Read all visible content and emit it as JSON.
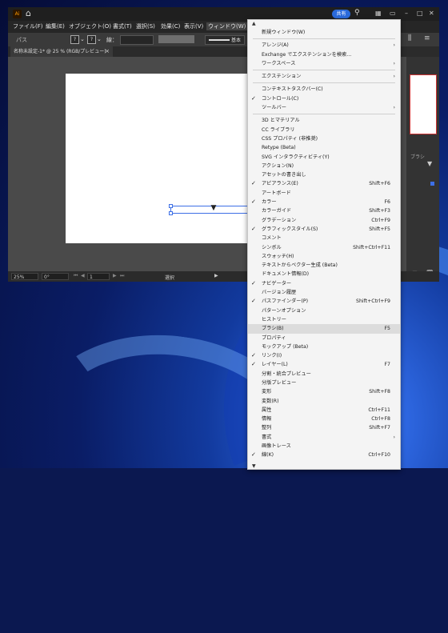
{
  "app": {
    "logo_text": "Ai",
    "share_label": "共有",
    "menus": [
      "ファイル(F)",
      "編集(E)",
      "オブジェクト(O)",
      "書式(T)",
      "選択(S)",
      "効果(C)",
      "表示(V)",
      "ウィンドウ(W)"
    ]
  },
  "controlbar": {
    "path_label": "パス",
    "stroke_label": "線：",
    "stroke_style_label": "基本"
  },
  "document": {
    "tab_label": "名称未設定-1* @ 25 % (RGB/プレビュー)"
  },
  "statusbar": {
    "zoom": "25%",
    "rotation": "0°",
    "page": "1",
    "tool": "選択"
  },
  "right_panel": {
    "label": "ブラシ"
  },
  "window_menu": {
    "items": [
      {
        "label": "新規ウィンドウ(W)",
        "checked": false,
        "shortcut": "",
        "submenu": false,
        "sep_after": true
      },
      {
        "label": "アレンジ(A)",
        "checked": false,
        "shortcut": "",
        "submenu": true,
        "sep_after": false
      },
      {
        "label": "Exchange でエクステンションを検索...",
        "checked": false,
        "shortcut": "",
        "submenu": false,
        "sep_after": false
      },
      {
        "label": "ワークスペース",
        "checked": false,
        "shortcut": "",
        "submenu": true,
        "sep_after": true
      },
      {
        "label": "エクステンション",
        "checked": false,
        "shortcut": "",
        "submenu": true,
        "sep_after": true
      },
      {
        "label": "コンテキストタスクバー(C)",
        "checked": false,
        "shortcut": "",
        "submenu": false,
        "sep_after": false
      },
      {
        "label": "コントロール(C)",
        "checked": true,
        "shortcut": "",
        "submenu": false,
        "sep_after": false
      },
      {
        "label": "ツールバー",
        "checked": false,
        "shortcut": "",
        "submenu": true,
        "sep_after": true
      },
      {
        "label": "3D とマテリアル",
        "checked": false,
        "shortcut": "",
        "submenu": false,
        "sep_after": false
      },
      {
        "label": "CC ライブラリ",
        "checked": false,
        "shortcut": "",
        "submenu": false,
        "sep_after": false
      },
      {
        "label": "CSS プロパティ (非推奨)",
        "checked": false,
        "shortcut": "",
        "submenu": false,
        "sep_after": false
      },
      {
        "label": "Retype (Beta)",
        "checked": false,
        "shortcut": "",
        "submenu": false,
        "sep_after": false
      },
      {
        "label": "SVG インタラクティビティ(Y)",
        "checked": false,
        "shortcut": "",
        "submenu": false,
        "sep_after": false
      },
      {
        "label": "アクション(N)",
        "checked": false,
        "shortcut": "",
        "submenu": false,
        "sep_after": false
      },
      {
        "label": "アセットの書き出し",
        "checked": false,
        "shortcut": "",
        "submenu": false,
        "sep_after": false
      },
      {
        "label": "アピアランス(E)",
        "checked": true,
        "shortcut": "Shift+F6",
        "submenu": false,
        "sep_after": false
      },
      {
        "label": "アートボード",
        "checked": false,
        "shortcut": "",
        "submenu": false,
        "sep_after": false
      },
      {
        "label": "カラー",
        "checked": true,
        "shortcut": "F6",
        "submenu": false,
        "sep_after": false
      },
      {
        "label": "カラーガイド",
        "checked": false,
        "shortcut": "Shift+F3",
        "submenu": false,
        "sep_after": false
      },
      {
        "label": "グラデーション",
        "checked": false,
        "shortcut": "Ctrl+F9",
        "submenu": false,
        "sep_after": false
      },
      {
        "label": "グラフィックスタイル(S)",
        "checked": true,
        "shortcut": "Shift+F5",
        "submenu": false,
        "sep_after": false
      },
      {
        "label": "コメント",
        "checked": false,
        "shortcut": "",
        "submenu": false,
        "sep_after": false
      },
      {
        "label": "シンボル",
        "checked": false,
        "shortcut": "Shift+Ctrl+F11",
        "submenu": false,
        "sep_after": false
      },
      {
        "label": "スウォッチ(H)",
        "checked": false,
        "shortcut": "",
        "submenu": false,
        "sep_after": false
      },
      {
        "label": "テキストからベクター生成 (Beta)",
        "checked": false,
        "shortcut": "",
        "submenu": false,
        "sep_after": false
      },
      {
        "label": "ドキュメント情報(D)",
        "checked": false,
        "shortcut": "",
        "submenu": false,
        "sep_after": false
      },
      {
        "label": "ナビゲーター",
        "checked": true,
        "shortcut": "",
        "submenu": false,
        "sep_after": false
      },
      {
        "label": "バージョン履歴",
        "checked": false,
        "shortcut": "",
        "submenu": false,
        "sep_after": false
      },
      {
        "label": "パスファインダー(P)",
        "checked": true,
        "shortcut": "Shift+Ctrl+F9",
        "submenu": false,
        "sep_after": false
      },
      {
        "label": "パターンオプション",
        "checked": false,
        "shortcut": "",
        "submenu": false,
        "sep_after": false
      },
      {
        "label": "ヒストリー",
        "checked": false,
        "shortcut": "",
        "submenu": false,
        "sep_after": false
      },
      {
        "label": "ブラシ(B)",
        "checked": false,
        "shortcut": "F5",
        "submenu": false,
        "sep_after": false,
        "highlighted": true
      },
      {
        "label": "プロパティ",
        "checked": false,
        "shortcut": "",
        "submenu": false,
        "sep_after": false
      },
      {
        "label": "モックアップ (Beta)",
        "checked": false,
        "shortcut": "",
        "submenu": false,
        "sep_after": false
      },
      {
        "label": "リンク(I)",
        "checked": true,
        "shortcut": "",
        "submenu": false,
        "sep_after": false
      },
      {
        "label": "レイヤー(L)",
        "checked": true,
        "shortcut": "F7",
        "submenu": false,
        "sep_after": false
      },
      {
        "label": "分割・統合プレビュー",
        "checked": false,
        "shortcut": "",
        "submenu": false,
        "sep_after": false
      },
      {
        "label": "分版プレビュー",
        "checked": false,
        "shortcut": "",
        "submenu": false,
        "sep_after": false
      },
      {
        "label": "変形",
        "checked": false,
        "shortcut": "Shift+F8",
        "submenu": false,
        "sep_after": false
      },
      {
        "label": "変数(R)",
        "checked": false,
        "shortcut": "",
        "submenu": false,
        "sep_after": false
      },
      {
        "label": "属性",
        "checked": false,
        "shortcut": "Ctrl+F11",
        "submenu": false,
        "sep_after": false
      },
      {
        "label": "情報",
        "checked": false,
        "shortcut": "Ctrl+F8",
        "submenu": false,
        "sep_after": false
      },
      {
        "label": "整列",
        "checked": false,
        "shortcut": "Shift+F7",
        "submenu": false,
        "sep_after": false
      },
      {
        "label": "書式",
        "checked": false,
        "shortcut": "",
        "submenu": true,
        "sep_after": false
      },
      {
        "label": "画像トレース",
        "checked": false,
        "shortcut": "",
        "submenu": false,
        "sep_after": false
      },
      {
        "label": "線(K)",
        "checked": true,
        "shortcut": "Ctrl+F10",
        "submenu": false,
        "sep_after": false
      }
    ]
  },
  "colors": {
    "accent": "#2b6bdc",
    "selection": "#3d6fe6",
    "app_bg": "#323232",
    "menu_bg": "#f4f4f4"
  }
}
